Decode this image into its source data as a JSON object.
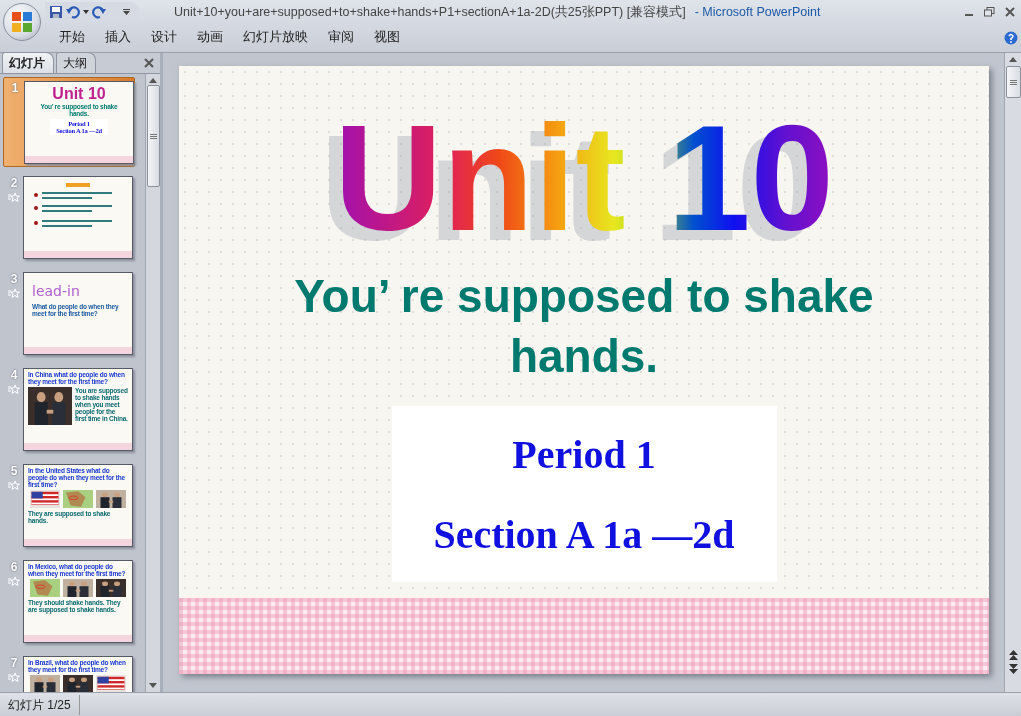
{
  "window": {
    "title": "Unit+10+you+are+supposed+to+shake+hands+P1+sectionA+1a-2D(共25张PPT) [兼容模式]",
    "app_name": "- Microsoft PowerPoint"
  },
  "menu": [
    "开始",
    "插入",
    "设计",
    "动画",
    "幻灯片放映",
    "审阅",
    "视图"
  ],
  "panel_tabs": [
    {
      "label": "幻灯片",
      "selected": true
    },
    {
      "label": "大纲",
      "selected": false
    }
  ],
  "thumbnails": [
    {
      "number": "1",
      "selected": true,
      "animated": false,
      "kind": "title",
      "texts": [
        "Unit 10",
        "You’ re supposed to shake hands.",
        "Period 1",
        "Section A 1a —2d"
      ]
    },
    {
      "number": "2",
      "selected": false,
      "animated": true,
      "kind": "bullets"
    },
    {
      "number": "3",
      "selected": false,
      "animated": true,
      "kind": "leadin",
      "texts": [
        "lead-in",
        "What do people do when they meet for the first time?"
      ]
    },
    {
      "number": "4",
      "selected": false,
      "animated": true,
      "kind": "photo_side",
      "texts": [
        "In China what do people do when they meet for the first time?",
        "You are supposed to shake hands when you meet people for the first time in China."
      ]
    },
    {
      "number": "5",
      "selected": false,
      "animated": true,
      "kind": "photo_row",
      "texts": [
        "In the United States what do people do when they meet for the first time?",
        "They are supposed to shake hands."
      ]
    },
    {
      "number": "6",
      "selected": false,
      "animated": true,
      "kind": "photo_row",
      "texts": [
        "In Mexico, what do people do when they meet for the first time?",
        "They should shake hands. They are supposed to shake hands."
      ]
    },
    {
      "number": "7",
      "selected": false,
      "animated": true,
      "kind": "photo_row",
      "texts": [
        "In Brazil, what do people do when they meet for the first time?"
      ]
    }
  ],
  "slide": {
    "heading": "Unit 10",
    "subtitle": "You’ re supposed to shake hands.",
    "period": "Period 1",
    "section": "Section A 1a —2d"
  },
  "status_bar": {
    "slide_counter": "幻灯片 1/25"
  }
}
